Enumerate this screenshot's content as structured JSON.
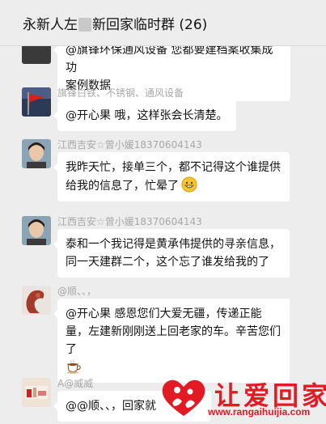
{
  "header": {
    "title_prefix": "永新人左",
    "title_suffix": "新回家临时群 (26)"
  },
  "messages": [
    {
      "sender": "",
      "lines": [
        "@旗锋环保通风设备 您都要建档案收集成功",
        "案例数据"
      ]
    },
    {
      "sender": "旗锋白铁、不锈钢、通风设备",
      "text": "@开心果 哦，这样张会长清楚。"
    },
    {
      "sender": "江西吉安☆曾小媛18370604143",
      "text": "我昨天忙，接单三个，都不记得这个谁提供给我的信息了，忙晕了",
      "emoji": "grin-emoji"
    },
    {
      "sender": "江西吉安☆曾小媛18370604143",
      "text": "泰和一个我记得是黄承伟提供的寻亲信息，同一天建群二个，这个忘了谁发给我的了"
    },
    {
      "sender": "@顺、、，",
      "text": "@开心果 感恩您们大爱无疆，传递正能量，左建新刚刚送上回老家的车。辛苦您们了",
      "emoji": "coffee-emoji"
    },
    {
      "sender": "A@威威",
      "text": "@@顺、、，回家就"
    }
  ],
  "watermark": {
    "text": "让爱回家",
    "url": "www.rangaihuijia.com"
  },
  "colors": {
    "background": "#ededed",
    "bubble": "#ffffff",
    "sender": "#a8a8a8",
    "brand_red": "#e11a24"
  }
}
